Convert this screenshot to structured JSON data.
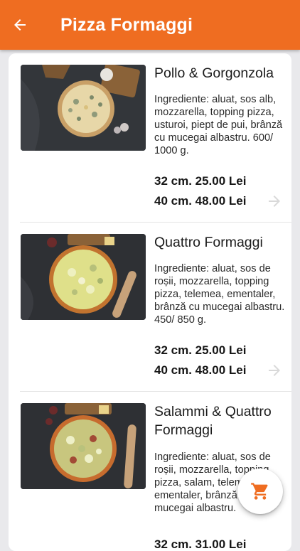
{
  "header": {
    "title": "Pizza Formaggi",
    "background": "#ef6d21",
    "back_icon": "arrow-left-icon"
  },
  "products": [
    {
      "name": "Pollo & Gorgonzola",
      "description": "Ingrediente: aluat, sos alb, mozzarella, topping pizza, usturoi, piept de pui, brânză cu mucegai albastru. 600/ 1000 g.",
      "price_small": "32 cm. 25.00 Lei",
      "price_large": "40 cm. 48.00 Lei"
    },
    {
      "name": "Quattro Formaggi",
      "description": "Ingrediente: aluat, sos de roșii, mozzarella, topping pizza, telemea, ementaler, brânză cu mucegai albastru. 450/ 850 g.",
      "price_small": "32 cm. 25.00 Lei",
      "price_large": "40 cm. 48.00 Lei"
    },
    {
      "name": "Salammi & Quattro Formaggi",
      "description": "Ingrediente: aluat, sos de roșii, mozzarella, topping pizza, salam, telemea, ementaler, brânză cu mucegai albastru.",
      "price_small": "32 cm. 31.00 Lei"
    }
  ],
  "cart_fab": {
    "icon": "shopping-cart-icon",
    "color": "#ef6d21"
  }
}
